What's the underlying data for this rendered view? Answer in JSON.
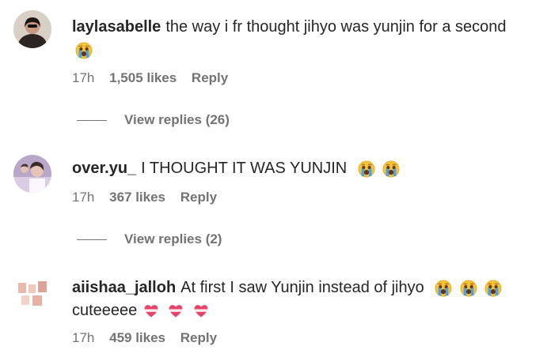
{
  "comments": [
    {
      "username": "laylasabelle",
      "text": "the way i fr thought jihyo was yunjin for a second",
      "emojis_inline": [],
      "emojis_newline": [
        "crying-face-icon"
      ],
      "time": "17h",
      "likes": "1,505 likes",
      "reply": "Reply",
      "view_replies": "View replies (26)"
    },
    {
      "username": "over.yu_",
      "text": "I THOUGHT IT WAS YUNJIN",
      "emojis_inline": [
        "crying-face-icon",
        "crying-face-icon"
      ],
      "time": "17h",
      "likes": "367 likes",
      "reply": "Reply",
      "view_replies": "View replies (2)"
    },
    {
      "username": "aiishaa_jalloh",
      "text": "At first I saw Yunjin instead of jihyo",
      "emojis_inline": [
        "crying-face-icon",
        "crying-face-icon",
        "crying-face-icon"
      ],
      "line2": "cuteeeee",
      "hearts": [
        "heart-ribbon-icon",
        "heart-ribbon-icon",
        "heart-ribbon-icon"
      ],
      "time": "17h",
      "likes": "459 likes",
      "reply": "Reply"
    }
  ],
  "colors": {
    "text": "#262626",
    "muted": "#737373",
    "emoji_yellow": "#f7c338",
    "heart": "#e8446a"
  }
}
